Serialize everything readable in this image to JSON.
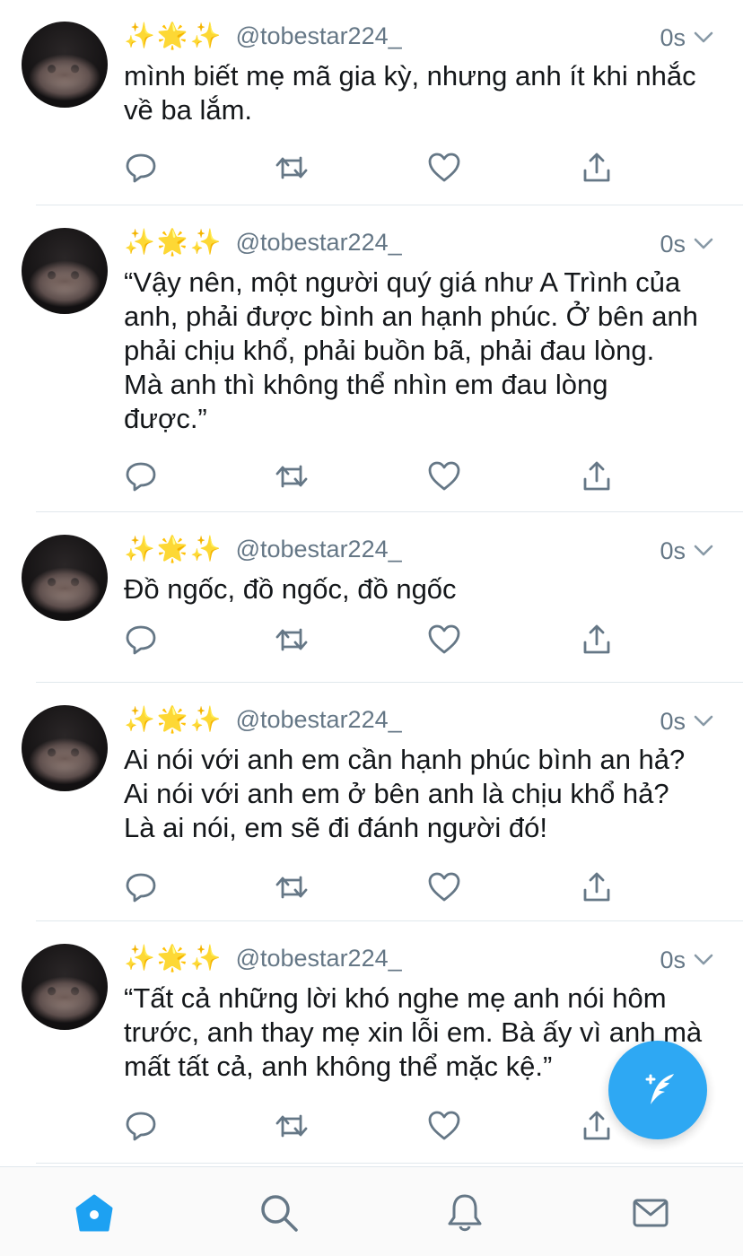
{
  "colors": {
    "accent": "#1da1f2",
    "text": "#14171a",
    "muted": "#657786",
    "divider": "#e1e8ed"
  },
  "tweets": [
    {
      "emojis": "✨🌟✨",
      "handle": "@tobestar224_",
      "time": "0s",
      "text": "mình biết mẹ mã gia kỳ, nhưng anh ít khi nhắc\nvề ba lắm."
    },
    {
      "emojis": "✨🌟✨",
      "handle": "@tobestar224_",
      "time": "0s",
      "text": "“Vậy nên, một người quý giá như A Trình của\nanh, phải được bình an hạnh phúc. Ở bên anh\nphải chịu khổ, phải buồn bã, phải đau lòng.\nMà anh thì không thể nhìn em đau lòng\nđược.”"
    },
    {
      "emojis": "✨🌟✨",
      "handle": "@tobestar224_",
      "time": "0s",
      "text": "Đồ ngốc, đồ ngốc, đồ ngốc"
    },
    {
      "emojis": "✨🌟✨",
      "handle": "@tobestar224_",
      "time": "0s",
      "text": "Ai nói với anh em cần hạnh phúc bình an hả?\nAi nói với anh em ở bên anh là chịu khổ hả?\nLà ai nói, em sẽ đi đánh người đó!"
    },
    {
      "emojis": "✨🌟✨",
      "handle": "@tobestar224_",
      "time": "0s",
      "text": "“Tất cả những lời khó nghe mẹ anh nói hôm\ntrước, anh thay mẹ xin lỗi em. Bà ấy vì anh mà\nmất tất cả, anh không thể mặc kệ.”"
    }
  ],
  "icons": {
    "reply": "reply-icon",
    "retweet": "retweet-icon",
    "like": "heart-icon",
    "share": "share-icon",
    "caret": "chevron-down-icon",
    "compose": "compose-tweet-icon",
    "tabs": [
      "home-icon",
      "search-icon",
      "notifications-icon",
      "messages-icon"
    ]
  },
  "tabbar": {
    "active_tab": "home"
  }
}
